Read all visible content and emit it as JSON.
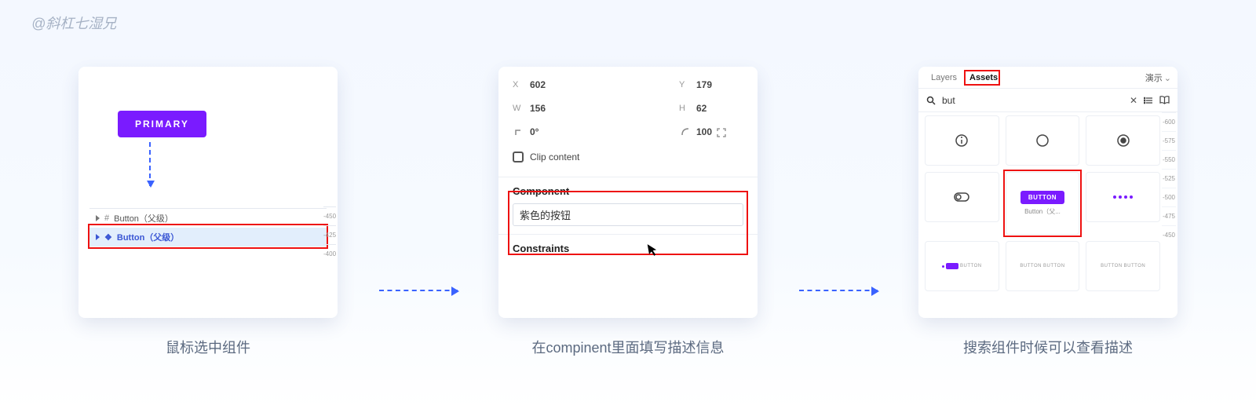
{
  "watermark": "@斜杠七湿兄",
  "captions": {
    "panel1": "鼠标选中组件",
    "panel2": "在compinent里面填写描述信息",
    "panel3": "搜索组件时候可以查看描述"
  },
  "panel1": {
    "primary_button_label": "PRIMARY",
    "layer_rows": [
      {
        "icon": "#",
        "label": "Button（父级）",
        "selected": false
      },
      {
        "icon": "❖",
        "label": "Button（父级）",
        "selected": true
      }
    ],
    "ruler": [
      "-450",
      "-425",
      "-400"
    ]
  },
  "panel2": {
    "props": {
      "x_label": "X",
      "x_value": "602",
      "y_label": "Y",
      "y_value": "179",
      "w_label": "W",
      "w_value": "156",
      "h_label": "H",
      "h_value": "62",
      "rot_value": "0°",
      "radius_value": "100"
    },
    "clip_label": "Clip content",
    "section_component": "Component",
    "description_value": "紫色的按钮",
    "section_constraints": "Constraints"
  },
  "panel3": {
    "tabs": {
      "layers": "Layers",
      "assets": "Assets"
    },
    "present_label": "演示",
    "search_query": "but",
    "featured": {
      "pill_label": "BUTTON",
      "caption": "Button（父..."
    },
    "bottom_text": "BUTTON",
    "ruler": [
      "-600",
      "-575",
      "-550",
      "-525",
      "-500",
      "-475",
      "-450"
    ]
  }
}
